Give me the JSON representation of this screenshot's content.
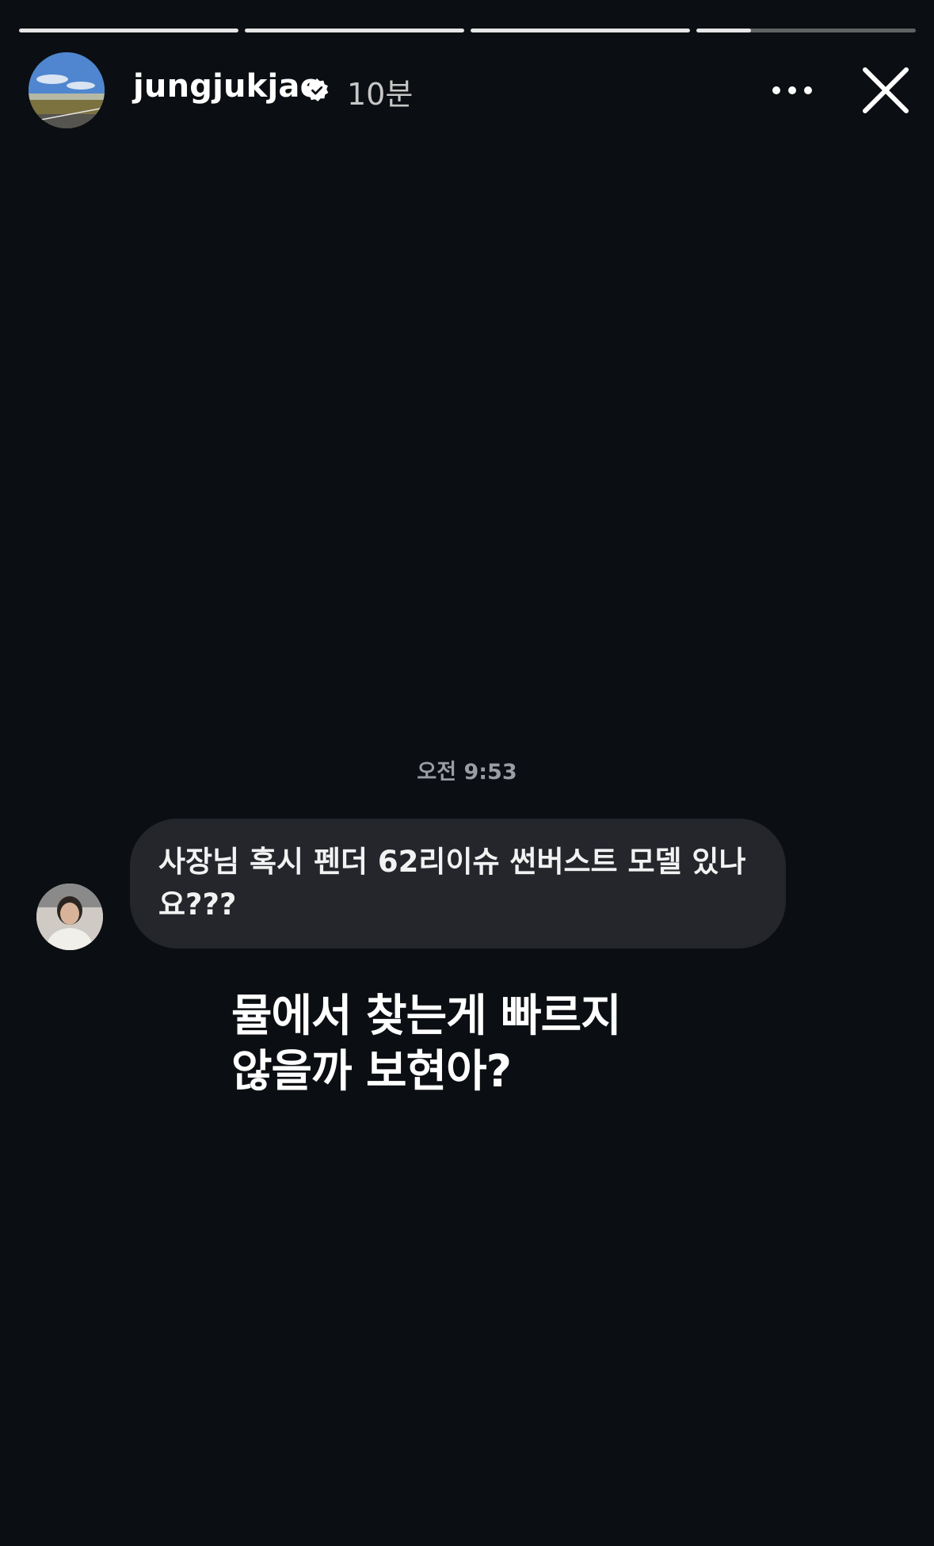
{
  "story": {
    "progress": [
      1,
      1,
      1,
      0.25
    ]
  },
  "header": {
    "username": "jungjukjae",
    "verified": true,
    "time_ago": "10분",
    "avatar_icon": "landscape-avatar-icon",
    "more_icon": "more-horizontal-icon",
    "close_icon": "close-icon"
  },
  "message": {
    "timestamp": "오전 9:53",
    "text": "사장님 혹시 펜더 62리이슈 썬버스트 모델 있나요???",
    "sender_avatar_icon": "person-avatar-icon"
  },
  "overlay": {
    "line1": "뮬에서 찾는게 빠르지",
    "line2": "않을까 보현아?"
  },
  "colors": {
    "background": "#0b0e12",
    "bubble": "#24262c",
    "timestamp": "#9a9da3"
  }
}
